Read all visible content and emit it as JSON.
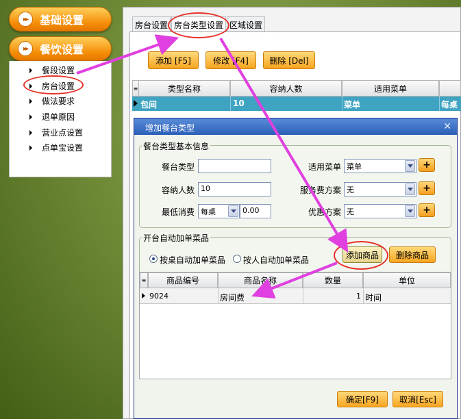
{
  "sidebar": {
    "sections": [
      {
        "label": "基础设置",
        "icon": "double-arrow-icon"
      },
      {
        "label": "餐饮设置",
        "icon": "double-arrow-icon"
      }
    ],
    "items": [
      {
        "label": "餐段设置"
      },
      {
        "label": "房台设置"
      },
      {
        "label": "做法要求"
      },
      {
        "label": "退单原因"
      },
      {
        "label": "营业点设置"
      },
      {
        "label": "点单宝设置"
      }
    ]
  },
  "tabs": [
    {
      "label": "房台设置"
    },
    {
      "label": "房台类型设置"
    },
    {
      "label": "区域设置"
    }
  ],
  "toolbar": {
    "add_label": "添加 [F5]",
    "edit_label": "修改 [F4]",
    "delete_label": "删除 [Del]"
  },
  "type_grid": {
    "headers": [
      "类型名称",
      "容纳人数",
      "适用菜单"
    ],
    "rows": [
      {
        "name": "包间",
        "capacity": "10",
        "menu": "菜单",
        "extra": "每桌"
      }
    ]
  },
  "dialog": {
    "title": "增加餐台类型",
    "basic_group": "餐台类型基本信息",
    "type_label": "餐台类型",
    "type_value": "",
    "capacity_label": "容纳人数",
    "capacity_value": "10",
    "min_spend_label": "最低消费",
    "min_spend_unit": "每桌",
    "min_spend_value": "0.00",
    "menu_label": "适用菜单",
    "menu_value": "菜单",
    "service_label": "服务费方案",
    "service_value": "无",
    "discount_label": "优惠方案",
    "discount_value": "无",
    "auto_group": "开台自动加单菜品",
    "radio_by_table": "按桌自动加单菜品",
    "radio_by_person": "按人自动加单菜品",
    "add_item_label": "添加商品",
    "delete_item_label": "删除商品",
    "item_headers": [
      "商品编号",
      "商品名称",
      "数量",
      "单位"
    ],
    "items": [
      {
        "code": "9024",
        "name": "房间费",
        "qty": "1",
        "unit": "时间"
      }
    ],
    "ok_label": "确定[F9]",
    "cancel_label": "取消[Esc]"
  },
  "colors": {
    "accent_orange": "#f48b05",
    "selected_row": "#3fa4c1",
    "annotation_red": "#e6332a",
    "annotation_arrow": "#e040e0"
  }
}
